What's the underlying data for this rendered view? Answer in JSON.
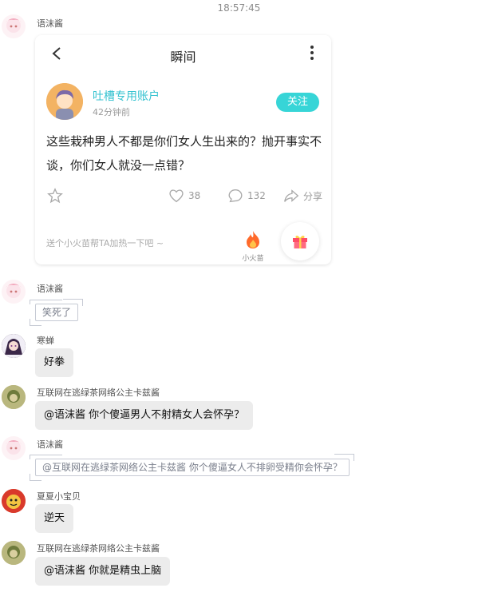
{
  "timestamp": "18:57:45",
  "card": {
    "sender": "语沫酱",
    "header_title": "瞬间",
    "account_name": "吐槽专用账户",
    "time_ago": "42分钟前",
    "follow_label": "关注",
    "post_text": "这些栽种男人不都是你们女人生出来的？抛开事实不谈，你们女人就没一点错？",
    "likes": "38",
    "comments": "132",
    "share_label": "分享",
    "promo_hint": "送个小火苗帮TA加热一下吧 ~",
    "fire_label": "小火苗",
    "accent_color": "#37d5d7"
  },
  "messages": [
    {
      "sender": "语沫酱",
      "text": "笑死了"
    },
    {
      "sender": "寒蝉",
      "text": "好拳"
    },
    {
      "sender": "互联网在逃绿茶网络公主卡兹酱",
      "text": "@语沫酱 你个傻逼男人不射精女人会怀孕？"
    },
    {
      "sender": "语沫酱",
      "text": "@互联网在逃绿茶网络公主卡兹酱 你个傻逼女人不排卵受精你会怀孕？"
    },
    {
      "sender": "夏夏小宝贝",
      "text": "逆天"
    },
    {
      "sender": "互联网在逃绿茶网络公主卡兹酱",
      "text": "@语沫酱 你就是精虫上脑"
    }
  ]
}
